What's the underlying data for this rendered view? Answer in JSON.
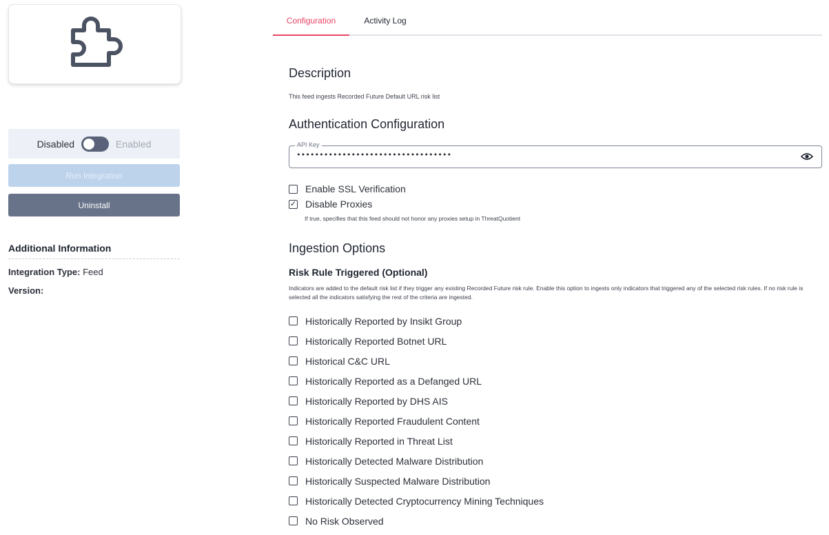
{
  "sidebar": {
    "logo_icon": "puzzle-piece-icon",
    "toggle": {
      "off_label": "Disabled",
      "on_label": "Enabled",
      "state": "disabled"
    },
    "run_button_label": "Run Integration",
    "uninstall_button_label": "Uninstall",
    "additional_info": {
      "title": "Additional Information",
      "type_label": "Integration Type:",
      "type_value": "Feed",
      "version_label": "Version:",
      "version_value": ""
    }
  },
  "tabs": [
    {
      "label": "Configuration",
      "active": true
    },
    {
      "label": "Activity Log",
      "active": false
    }
  ],
  "description": {
    "title": "Description",
    "text": "This feed ingests Recorded Future Default URL risk list"
  },
  "auth": {
    "title": "Authentication Configuration",
    "api_key_label": "API Key",
    "api_key_value": "••••••••••••••••••••••••••••••••••",
    "reveal_icon": "eye-icon",
    "ssl_label": "Enable SSL Verification",
    "ssl_checked": false,
    "proxy_label": "Disable Proxies",
    "proxy_checked": true,
    "proxy_help": "If true, specifies that this feed should not honor any proxies setup in ThreatQuotient"
  },
  "ingestion": {
    "title": "Ingestion Options",
    "risk_title": "Risk Rule Triggered (Optional)",
    "risk_help": "Indicators are added to the default risk list if they trigger any existing Recorded Future risk rule. Enable this option to ingests only indicators that triggered any of the selected risk rules. If no risk rule is selected all the indicators satisfying the rest of the criteria are ingested.",
    "risk_rules": [
      {
        "label": "Historically Reported by Insikt Group",
        "checked": false
      },
      {
        "label": "Historically Reported Botnet URL",
        "checked": false
      },
      {
        "label": "Historical C&C URL",
        "checked": false
      },
      {
        "label": "Historically Reported as a Defanged URL",
        "checked": false
      },
      {
        "label": "Historically Reported by DHS AIS",
        "checked": false
      },
      {
        "label": "Historically Reported Fraudulent Content",
        "checked": false
      },
      {
        "label": "Historically Reported in Threat List",
        "checked": false
      },
      {
        "label": "Historically Detected Malware Distribution",
        "checked": false
      },
      {
        "label": "Historically Suspected Malware Distribution",
        "checked": false
      },
      {
        "label": "Historically Detected Cryptocurrency Mining Techniques",
        "checked": false
      },
      {
        "label": "No Risk Observed",
        "checked": false
      }
    ]
  },
  "colors": {
    "accent": "#e84462",
    "uninstall_bg": "#687389",
    "run_bg": "#bdd3ec",
    "toggle_bg": "#edf1f7"
  }
}
